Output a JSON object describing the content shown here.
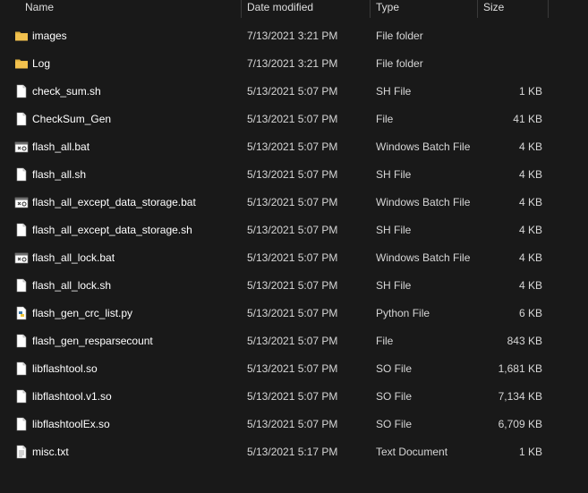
{
  "header": {
    "name": "Name",
    "date": "Date modified",
    "type": "Type",
    "size": "Size"
  },
  "colors": {
    "background": "#191919",
    "folder": "#f2c14e",
    "text": "#ffffff",
    "secondary_text": "#d6d6d6"
  },
  "files": [
    {
      "name": "images",
      "date": "7/13/2021 3:21 PM",
      "type": "File folder",
      "size": "",
      "icon": "folder-icon"
    },
    {
      "name": "Log",
      "date": "7/13/2021 3:21 PM",
      "type": "File folder",
      "size": "",
      "icon": "folder-icon"
    },
    {
      "name": "check_sum.sh",
      "date": "5/13/2021 5:07 PM",
      "type": "SH File",
      "size": "1 KB",
      "icon": "file-icon"
    },
    {
      "name": "CheckSum_Gen",
      "date": "5/13/2021 5:07 PM",
      "type": "File",
      "size": "41 KB",
      "icon": "file-icon"
    },
    {
      "name": "flash_all.bat",
      "date": "5/13/2021 5:07 PM",
      "type": "Windows Batch File",
      "size": "4 KB",
      "icon": "batch-file-icon"
    },
    {
      "name": "flash_all.sh",
      "date": "5/13/2021 5:07 PM",
      "type": "SH File",
      "size": "4 KB",
      "icon": "file-icon"
    },
    {
      "name": "flash_all_except_data_storage.bat",
      "date": "5/13/2021 5:07 PM",
      "type": "Windows Batch File",
      "size": "4 KB",
      "icon": "batch-file-icon"
    },
    {
      "name": "flash_all_except_data_storage.sh",
      "date": "5/13/2021 5:07 PM",
      "type": "SH File",
      "size": "4 KB",
      "icon": "file-icon"
    },
    {
      "name": "flash_all_lock.bat",
      "date": "5/13/2021 5:07 PM",
      "type": "Windows Batch File",
      "size": "4 KB",
      "icon": "batch-file-icon"
    },
    {
      "name": "flash_all_lock.sh",
      "date": "5/13/2021 5:07 PM",
      "type": "SH File",
      "size": "4 KB",
      "icon": "file-icon"
    },
    {
      "name": "flash_gen_crc_list.py",
      "date": "5/13/2021 5:07 PM",
      "type": "Python File",
      "size": "6 KB",
      "icon": "python-file-icon"
    },
    {
      "name": "flash_gen_resparsecount",
      "date": "5/13/2021 5:07 PM",
      "type": "File",
      "size": "843 KB",
      "icon": "file-icon"
    },
    {
      "name": "libflashtool.so",
      "date": "5/13/2021 5:07 PM",
      "type": "SO File",
      "size": "1,681 KB",
      "icon": "file-icon"
    },
    {
      "name": "libflashtool.v1.so",
      "date": "5/13/2021 5:07 PM",
      "type": "SO File",
      "size": "7,134 KB",
      "icon": "file-icon"
    },
    {
      "name": "libflashtoolEx.so",
      "date": "5/13/2021 5:07 PM",
      "type": "SO File",
      "size": "6,709 KB",
      "icon": "file-icon"
    },
    {
      "name": "misc.txt",
      "date": "5/13/2021 5:17 PM",
      "type": "Text Document",
      "size": "1 KB",
      "icon": "text-file-icon"
    }
  ]
}
